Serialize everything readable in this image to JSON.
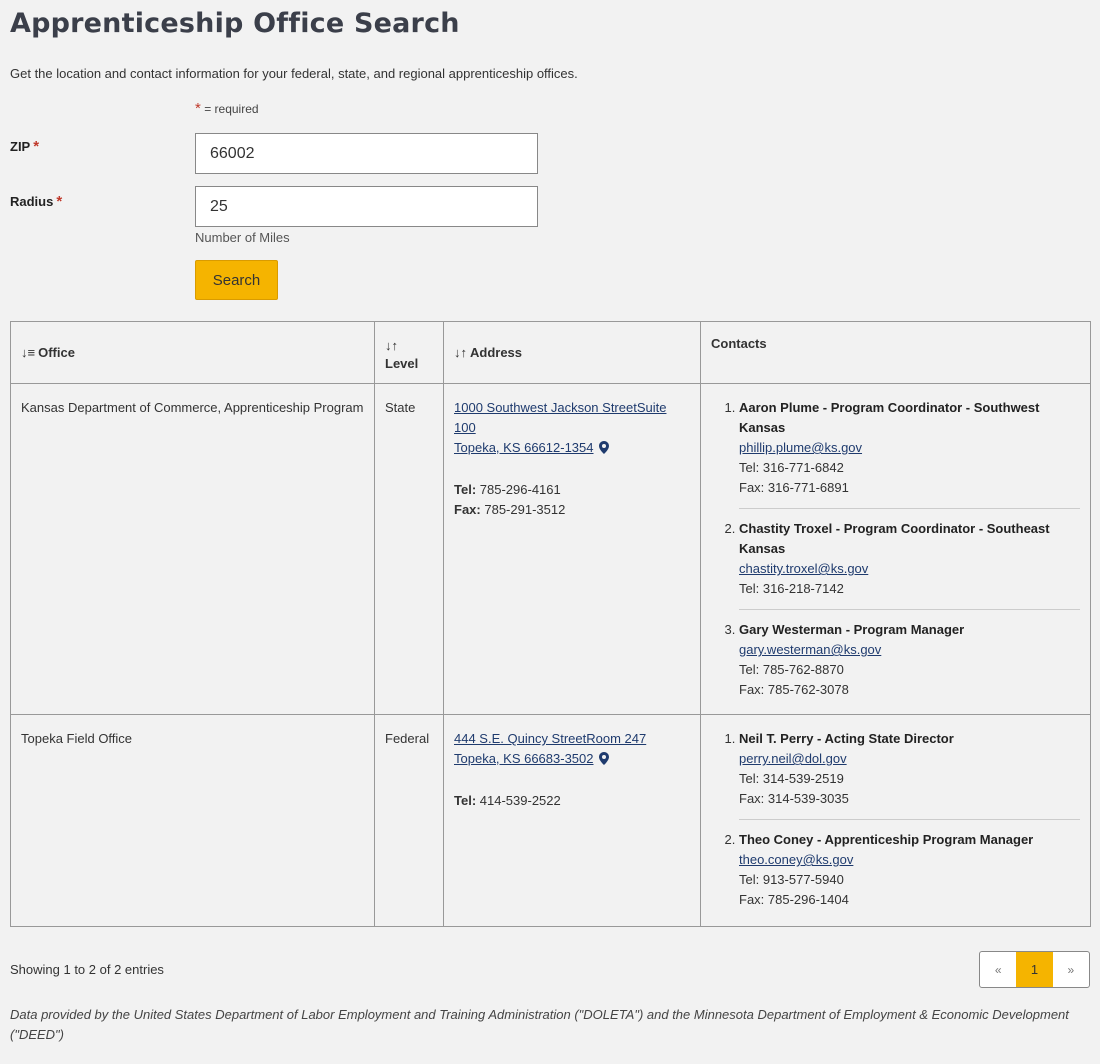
{
  "page": {
    "title": "Apprenticeship Office Search",
    "intro": "Get the location and contact information for your federal, state, and regional apprenticeship offices.",
    "required_note": "= required",
    "required_star": "*"
  },
  "form": {
    "zip_label": "ZIP",
    "zip_value": "66002",
    "radius_label": "Radius",
    "radius_value": "25",
    "radius_hint": "Number of Miles",
    "search_label": "Search"
  },
  "table": {
    "headers": {
      "office": "Office",
      "level": "Level",
      "address": "Address",
      "contacts": "Contacts"
    },
    "sort_icons": {
      "office": "↓≡",
      "level": "↓↑",
      "address": "↓↑"
    },
    "rows": [
      {
        "office": "Kansas Department of Commerce, Apprenticeship Program",
        "level": "State",
        "address_line1": "1000 Southwest Jackson StreetSuite 100",
        "address_line2": "Topeka, KS 66612-1354",
        "tel_label": "Tel:",
        "tel": "785-296-4161",
        "fax_label": "Fax:",
        "fax": "785-291-3512",
        "contacts": [
          {
            "name": "Aaron Plume - Program Coordinator - Southwest Kansas",
            "email": "phillip.plume@ks.gov",
            "tel": "Tel: 316-771-6842",
            "fax": "Fax: 316-771-6891"
          },
          {
            "name": "Chastity Troxel - Program Coordinator - Southeast Kansas",
            "email": "chastity.troxel@ks.gov",
            "tel": "Tel: 316-218-7142",
            "fax": ""
          },
          {
            "name": "Gary Westerman - Program Manager",
            "email": "gary.westerman@ks.gov",
            "tel": "Tel: 785-762-8870",
            "fax": "Fax: 785-762-3078"
          }
        ]
      },
      {
        "office": "Topeka Field Office",
        "level": "Federal",
        "address_line1": "444 S.E. Quincy StreetRoom 247",
        "address_line2": "Topeka, KS 66683-3502",
        "tel_label": "Tel:",
        "tel": "414-539-2522",
        "fax_label": "",
        "fax": "",
        "contacts": [
          {
            "name": "Neil T. Perry - Acting State Director",
            "email": "perry.neil@dol.gov",
            "tel": "Tel: 314-539-2519",
            "fax": "Fax: 314-539-3035"
          },
          {
            "name": "Theo Coney - Apprenticeship Program Manager",
            "email": "theo.coney@ks.gov",
            "tel": "Tel: 913-577-5940",
            "fax": "Fax: 785-296-1404"
          }
        ]
      }
    ]
  },
  "status": "Showing 1 to 2 of 2 entries",
  "pager": {
    "prev": "«",
    "current": "1",
    "next": "»"
  },
  "footer": "Data provided by the United States Department of Labor Employment and Training Administration (\"DOLETA\") and the Minnesota Department of Employment & Economic Development (\"DEED\")",
  "colors": {
    "accent": "#f5b400",
    "link": "#1f3b6e",
    "required": "#c0392b"
  },
  "icons": {
    "pin": "map-pin-icon",
    "sort": "sort-icon"
  }
}
